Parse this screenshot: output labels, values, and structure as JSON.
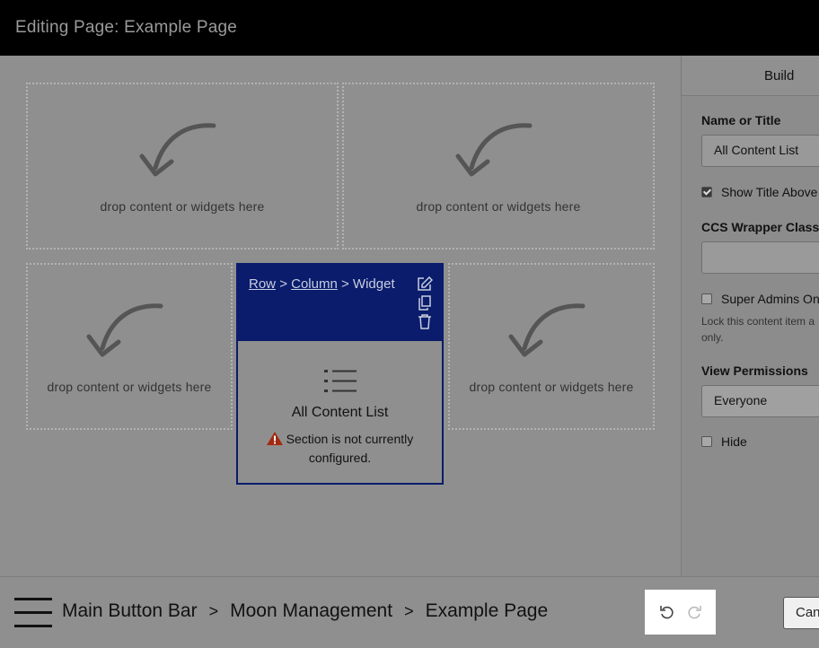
{
  "header": {
    "title": "Editing Page: Example Page"
  },
  "dropzones": [
    {
      "label": "drop content or widgets here"
    },
    {
      "label": "drop content or widgets here"
    },
    {
      "label": "drop content or widgets here"
    },
    {
      "label": "drop content or widgets here"
    }
  ],
  "widget": {
    "breadcrumb": {
      "row": "Row",
      "sep1": ">",
      "column": "Column",
      "sep2": ">",
      "widget": "Widget"
    },
    "title": "All Content List",
    "warning": "Section is not currently configured.",
    "icons": [
      "edit-icon",
      "copy-icon",
      "trash-icon",
      "list-icon",
      "warning-icon"
    ]
  },
  "panel": {
    "tab": "Build",
    "name_label": "Name or Title",
    "name_value": "All Content List",
    "show_title": {
      "label": "Show Title Above",
      "checked": true
    },
    "css_label": "CCS Wrapper Class",
    "css_value": "",
    "super_admins": {
      "label": "Super Admins Only",
      "checked": false
    },
    "help_line1": "Lock this content item a",
    "help_line2": "only.",
    "view_label": "View Permissions",
    "view_value": "Everyone",
    "hide": {
      "label": "Hide",
      "checked": false
    }
  },
  "footer": {
    "crumbs": [
      "Main Button Bar",
      "Moon Management",
      "Example Page"
    ],
    "separator": ">",
    "cancel_label": "Cancel",
    "icons": [
      "menu-icon",
      "undo-icon",
      "redo-icon"
    ]
  }
}
